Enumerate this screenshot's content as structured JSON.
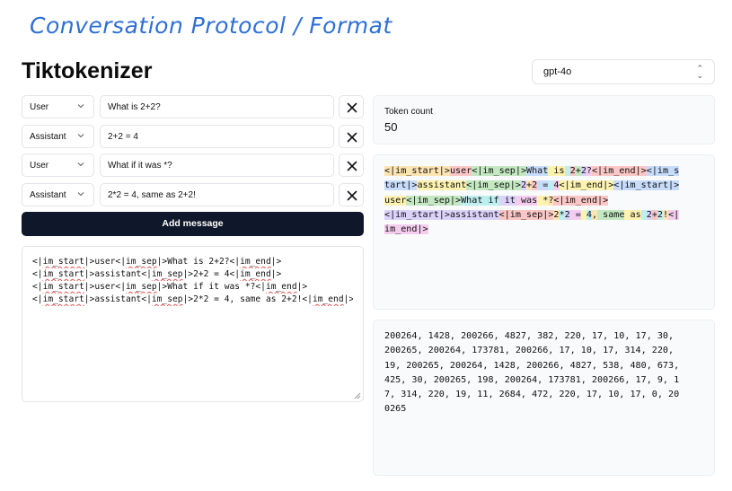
{
  "slide_title": "Conversation Protocol / Format",
  "app_title": "Tiktokenizer",
  "model_select": {
    "value": "gpt-4o"
  },
  "messages": [
    {
      "role": "User",
      "content": "What is 2+2?"
    },
    {
      "role": "Assistant",
      "content": "2+2 = 4"
    },
    {
      "role": "User",
      "content": "What if it was *?"
    },
    {
      "role": "Assistant",
      "content": "2*2 = 4, same as 2+2!"
    }
  ],
  "add_message_label": "Add message",
  "raw_text": [
    "<|im_start|>user<|im_sep|>What is 2+2?<|im_end|>",
    "<|im_start|>assistant<|im_sep|>2+2 = 4<|im_end|>",
    "<|im_start|>user<|im_sep|>What if it was *?<|im_end|>",
    "<|im_start|>assistant<|im_sep|>2*2 = 4, same as 2+2!<|im_end|>"
  ],
  "token_count_label": "Token count",
  "token_count": "50",
  "token_colors": [
    "#dcd3fb",
    "#c4e8c2",
    "#fde4b3",
    "#fbc6c6",
    "#c7dcfb",
    "#bdeef0",
    "#f4cdee",
    "#fdf2b0"
  ],
  "token_lines": [
    [
      [
        "<|im_start|>",
        2
      ],
      [
        "user",
        3
      ],
      [
        "<|im_sep|>",
        1
      ],
      [
        "What",
        4
      ],
      [
        " is",
        7
      ],
      [
        " ",
        5
      ],
      [
        "2",
        3
      ],
      [
        "+",
        1
      ],
      [
        "2",
        0
      ],
      [
        "?",
        6
      ],
      [
        "<|im_end|>",
        3
      ],
      [
        "<|im_s",
        4
      ]
    ],
    [
      [
        "tart|>",
        4
      ],
      [
        "assistant",
        7
      ],
      [
        "<|im_sep|>",
        1
      ],
      [
        "2",
        0
      ],
      [
        "+",
        2
      ],
      [
        "2",
        3
      ],
      [
        " =",
        4
      ],
      [
        " ",
        5
      ],
      [
        "4",
        6
      ],
      [
        "<|im_end|>",
        7
      ],
      [
        "<|im_start|>",
        4
      ]
    ],
    [
      [
        "user",
        7
      ],
      [
        "<|im_sep|>",
        1
      ],
      [
        "What",
        5
      ],
      [
        " if",
        5
      ],
      [
        " it",
        0
      ],
      [
        " was",
        6
      ],
      [
        " *",
        7
      ],
      [
        "?",
        2
      ],
      [
        "<|im_end|>",
        3
      ]
    ],
    [
      [
        "<|im_start|>",
        0
      ],
      [
        "assistant",
        0
      ],
      [
        "<|im_sep|>",
        3
      ],
      [
        "2",
        2
      ],
      [
        "*",
        5
      ],
      [
        "2",
        0
      ],
      [
        " =",
        6
      ],
      [
        " ",
        7
      ],
      [
        "4",
        5
      ],
      [
        ",",
        2
      ],
      [
        " same",
        1
      ],
      [
        " as",
        7
      ],
      [
        " ",
        5
      ],
      [
        "2",
        0
      ],
      [
        "+",
        3
      ],
      [
        "2",
        5
      ],
      [
        "!",
        2
      ],
      [
        "<|",
        6
      ]
    ],
    [
      [
        "im_end|>",
        6
      ]
    ]
  ],
  "token_id_lines": [
    "200264, 1428, 200266, 4827, 382, 220, 17, 10, 17, 30,",
    "200265, 200264, 173781, 200266, 17, 10, 17, 314, 220,",
    "19, 200265, 200264, 1428, 200266, 4827, 538, 480, 673,",
    "425, 30, 200265, 198, 200264, 173781, 200266, 17, 9, 1",
    "7, 314, 220, 19, 11, 2684, 472, 220, 17, 10, 17, 0, 20",
    "0265"
  ]
}
